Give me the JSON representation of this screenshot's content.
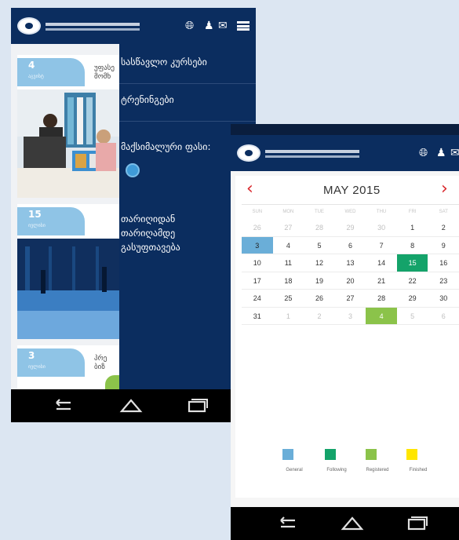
{
  "left_screen": {
    "courses": [
      {
        "day": "4",
        "month": "აგვისტ",
        "title": "უფასე\nმომხ"
      },
      {
        "day": "15",
        "month": "ივლისი",
        "title": ""
      },
      {
        "day": "3",
        "month": "ივლისი",
        "title": "პრე\nბიზ"
      }
    ],
    "menu": {
      "items": [
        "სასწავლო კურსები",
        "ტრენინგები",
        "მაქსიმალური ფასი:",
        "თარიღიდან",
        "თარიღამდე",
        "გასუფთავება"
      ]
    }
  },
  "right_screen": {
    "calendar": {
      "month_label": "MAY 2015",
      "prev_arrow": "‹",
      "next_arrow": "›",
      "weekdays": [
        "SUN",
        "MON",
        "TUE",
        "WED",
        "THU",
        "FRI",
        "SAT"
      ],
      "weeks": [
        [
          {
            "d": "26",
            "t": "other"
          },
          {
            "d": "27",
            "t": "other"
          },
          {
            "d": "28",
            "t": "other"
          },
          {
            "d": "29",
            "t": "other"
          },
          {
            "d": "30",
            "t": "other"
          },
          {
            "d": "1",
            "t": ""
          },
          {
            "d": "2",
            "t": ""
          }
        ],
        [
          {
            "d": "3",
            "t": "general"
          },
          {
            "d": "4",
            "t": ""
          },
          {
            "d": "5",
            "t": ""
          },
          {
            "d": "6",
            "t": ""
          },
          {
            "d": "7",
            "t": ""
          },
          {
            "d": "8",
            "t": ""
          },
          {
            "d": "9",
            "t": ""
          }
        ],
        [
          {
            "d": "10",
            "t": ""
          },
          {
            "d": "11",
            "t": ""
          },
          {
            "d": "12",
            "t": ""
          },
          {
            "d": "13",
            "t": ""
          },
          {
            "d": "14",
            "t": ""
          },
          {
            "d": "15",
            "t": "following"
          },
          {
            "d": "16",
            "t": ""
          }
        ],
        [
          {
            "d": "17",
            "t": ""
          },
          {
            "d": "18",
            "t": ""
          },
          {
            "d": "19",
            "t": ""
          },
          {
            "d": "20",
            "t": ""
          },
          {
            "d": "21",
            "t": ""
          },
          {
            "d": "22",
            "t": ""
          },
          {
            "d": "23",
            "t": ""
          }
        ],
        [
          {
            "d": "24",
            "t": ""
          },
          {
            "d": "25",
            "t": ""
          },
          {
            "d": "26",
            "t": ""
          },
          {
            "d": "27",
            "t": ""
          },
          {
            "d": "28",
            "t": ""
          },
          {
            "d": "29",
            "t": ""
          },
          {
            "d": "30",
            "t": ""
          }
        ],
        [
          {
            "d": "31",
            "t": ""
          },
          {
            "d": "1",
            "t": "other"
          },
          {
            "d": "2",
            "t": "other"
          },
          {
            "d": "3",
            "t": "other"
          },
          {
            "d": "4",
            "t": "registered"
          },
          {
            "d": "5",
            "t": "other"
          },
          {
            "d": "6",
            "t": "other"
          }
        ]
      ]
    },
    "legend": [
      {
        "label": "General",
        "color": "#6aaed8"
      },
      {
        "label": "Following",
        "color": "#14a36a"
      },
      {
        "label": "Registered",
        "color": "#8bc34a"
      },
      {
        "label": "Finished",
        "color": "#ffe600"
      }
    ]
  },
  "colors": {
    "header_navy": "#0b2d5f",
    "accent_red": "#d9262b",
    "tab_blue": "#8fc4e6"
  },
  "icons": [
    "logo-icon",
    "globe-icon",
    "user-icon",
    "mail-icon",
    "menu-icon",
    "back-icon",
    "home-icon",
    "recent-apps-icon"
  ]
}
